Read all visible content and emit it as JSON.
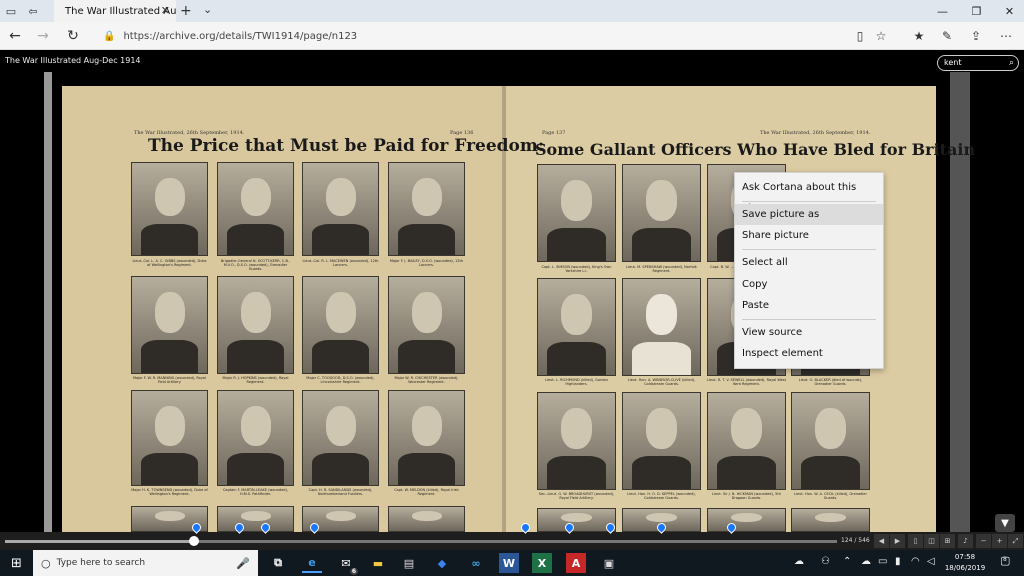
{
  "browser": {
    "tab_title": "The War Illustrated Aug",
    "tab_close": "✕",
    "new_tab": "+",
    "tab_menu": "⌄",
    "url": "https://archive.org/details/TWI1914/page/n123",
    "win_minimize": "—",
    "win_restore": "❐",
    "win_close": "✕",
    "back": "←",
    "forward": "→",
    "refresh": "↻"
  },
  "viewer": {
    "book_title": "The War Illustrated Aug-Dec 1914",
    "search_value": "kent",
    "page_count": "124 / 546"
  },
  "left_page": {
    "header_left": "The War Illustrated, 26th September, 1914.",
    "header_right": "Page 136",
    "title": "The Price that Must be Paid for Freedom:",
    "captions": [
      "Lieut.-Col. L. A. C. GIBBS (wounded), Duke of Wellington's Regiment.",
      "Brigadier-General N. SCOTT-KERR, C.B., M.V.O., D.S.O. (wounded), Grenadier Guards.",
      "Lieut.-Col. R. L. MACEWEN (wounded), 12th Lancers.",
      "Major F. J. BAILEY, D.S.O. (wounded), 12th Lancers.",
      "Major F. W. R. MANNING (wounded), Royal Field Artillery.",
      "Major R. J. HOPKINS (wounded), Royal Regiment.",
      "Major C. TOOGOOD, D.S.O. (wounded), Lincolnshire Regiment.",
      "Major W. R. CHICHESTER (wounded), Worcester Regiment.",
      "Major H. K. TOWNSEND (wounded), Duke of Wellington's Regiment.",
      "Captain F. MARTIN-LEAKE (wounded), H.M.S. Pathfinder.",
      "Capt. H. R. SANDILANDS (wounded), Northumberland Fusiliers.",
      "Capt. W. MELDON (killed), Royal Irish Regiment."
    ]
  },
  "right_page": {
    "header_left": "Page 137",
    "header_right": "The War Illustrated, 26th September, 1914.",
    "title": "Some Gallant Officers Who Have Bled for Britain",
    "captions": [
      "Capt. L. SIMSON (wounded), King's Own Yorkshire L.I.",
      "Lieut. M. SPENSHAW (wounded), Norfolk Regiment.",
      "Capt. B. W. ...",
      "",
      "Lieut. L. RICHMOND (killed), Gordon Highlanders.",
      "Lieut. Hon. A. WINDSOR-CLIVE (killed), Coldstream Guards.",
      "Lieut. R. T. V. SEWELL (wounded), Royal West Kent Regiment.",
      "Lieut. O. BLACKER (died of wounds), Grenadier Guards.",
      "Sec.-Lieut. G. W. BROADHURST (wounded), Royal Field Artillery.",
      "Lieut. Hon. H. O. D. KEPPEL (wounded), Coldstream Guards.",
      "Lieut. Sir J. B. HICKMAN (wounded), 5th Dragoon Guards.",
      "Lieut. Hon. W. A. CECIL (killed), Grenadier Guards."
    ]
  },
  "context_menu": {
    "items": [
      "Ask Cortana about this picture",
      "Save picture as",
      "Share picture",
      "Select all",
      "Copy",
      "Paste",
      "View source",
      "Inspect element"
    ]
  },
  "taskbar": {
    "search_placeholder": "Type here to search",
    "mail_badge": "6",
    "time": "07:58",
    "date": "18/06/2019",
    "notification_count": "8"
  }
}
